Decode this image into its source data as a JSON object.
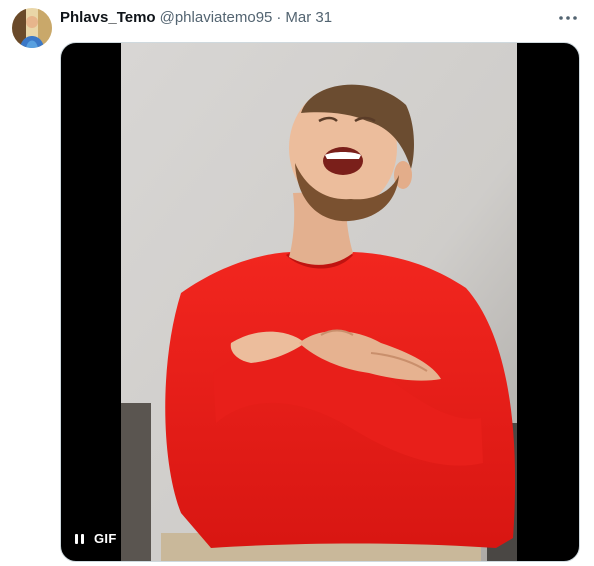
{
  "tweet": {
    "author": {
      "display_name": "Phlavs_Temo",
      "handle": "@phlaviatemo95",
      "avatar_icon": "user-avatar"
    },
    "separator": "·",
    "date": "Mar 31",
    "more_icon": "more-horizontal-icon",
    "media": {
      "type": "gif",
      "badge_label": "GIF",
      "pause_icon": "pause-icon",
      "subject": "man-laughing-hands-on-chest"
    }
  },
  "colors": {
    "text_primary": "#0f1419",
    "text_secondary": "#536471",
    "border": "#cfd9de",
    "sweater_red": "#e11d1d",
    "media_background": "#000000"
  }
}
